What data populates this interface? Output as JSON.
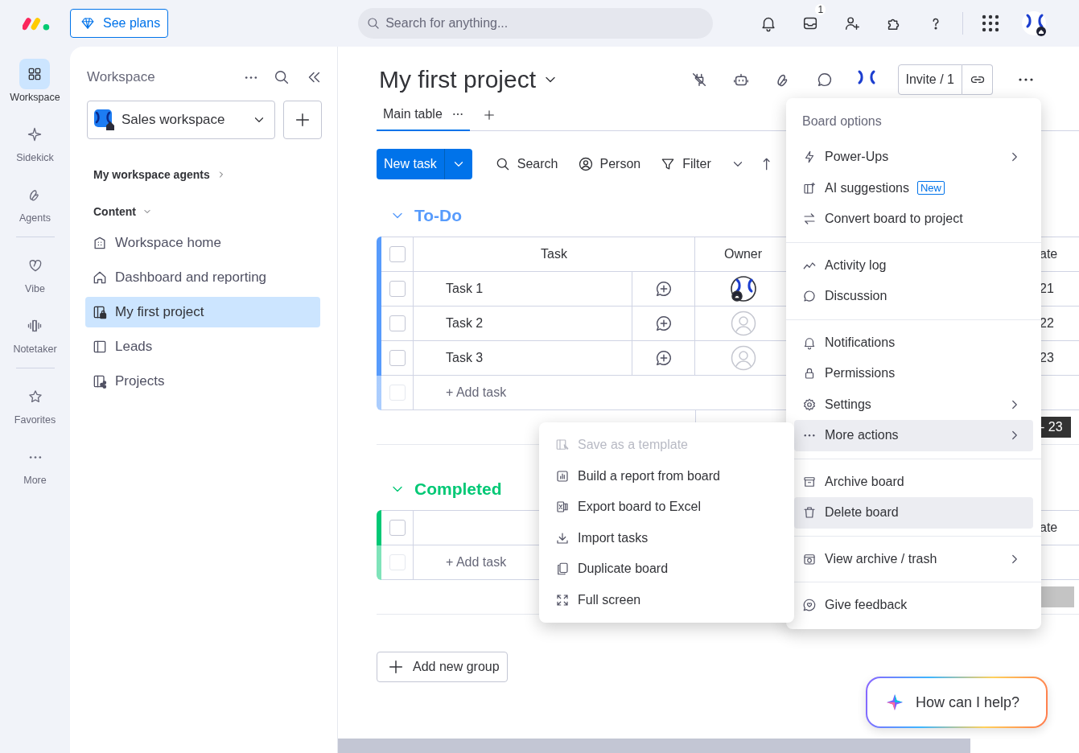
{
  "top_bar": {
    "upgrade_button": "See plans",
    "search": {
      "placeholder": "Search for anything..."
    },
    "inbox_badge": "1"
  },
  "rail": {
    "items": [
      {
        "label": "Workspace",
        "selected": true
      },
      {
        "label": "Sidekick",
        "selected": false
      },
      {
        "label": "Agents",
        "selected": false
      },
      {
        "label": "Vibe",
        "selected": false
      },
      {
        "label": "Notetaker",
        "selected": false
      },
      {
        "label": "Favorites",
        "selected": false
      },
      {
        "label": "More",
        "selected": false
      }
    ]
  },
  "workspace_panel": {
    "title": "Workspace",
    "workspace_select": "Sales workspace",
    "agents_link": "My workspace agents",
    "section": {
      "label": "Content",
      "expanded": true
    },
    "items": [
      {
        "label": "Workspace home",
        "selected": false
      },
      {
        "label": "Dashboard and reporting",
        "selected": false
      },
      {
        "label": "My first project",
        "selected": true
      },
      {
        "label": "Leads",
        "selected": false
      },
      {
        "label": "Projects",
        "selected": false
      }
    ]
  },
  "board": {
    "title": "My first project",
    "invite_button": "Invite / 1",
    "views": [
      {
        "label": "Main table",
        "selected": true
      }
    ],
    "new_task_button": "New task",
    "toolbar": [
      "Search",
      "Person",
      "Filter"
    ],
    "groups": [
      {
        "name": "To-Do",
        "color": "#579bfc",
        "columns": {
          "task": "Task",
          "owner": "Owner",
          "column_4": "ate"
        },
        "header_checked": false,
        "add_row_checked": false,
        "rows": [
          {
            "name": "Task 1",
            "checked": false,
            "owner_assigned": true,
            "column_4": "21"
          },
          {
            "name": "Task 2",
            "checked": false,
            "owner_assigned": false,
            "column_4": "22"
          },
          {
            "name": "Task 3",
            "checked": false,
            "owner_assigned": false,
            "column_4": "23"
          }
        ],
        "add_row": "+ Add task",
        "summary": "- 23"
      },
      {
        "name": "Completed",
        "color": "#00c875",
        "columns": {
          "column_4": "ate"
        },
        "header_checked": false,
        "add_row_checked": false,
        "add_row": "+ Add task"
      }
    ],
    "add_group_button": "Add new group"
  },
  "board_menu": {
    "title": "Board options",
    "sections": [
      {
        "items": [
          {
            "label": "Power-Ups",
            "submenu": true,
            "highlighted": false
          },
          {
            "label": "AI suggestions",
            "badge": "New",
            "submenu": false,
            "highlighted": false
          },
          {
            "label": "Convert board to project",
            "submenu": false,
            "highlighted": false
          }
        ]
      },
      {
        "items": [
          {
            "label": "Activity log",
            "submenu": false,
            "highlighted": false
          },
          {
            "label": "Discussion",
            "submenu": false,
            "highlighted": false
          }
        ]
      },
      {
        "items": [
          {
            "label": "Notifications",
            "submenu": false,
            "highlighted": false
          },
          {
            "label": "Permissions",
            "submenu": false,
            "highlighted": false
          },
          {
            "label": "Settings",
            "submenu": true,
            "highlighted": false
          },
          {
            "label": "More actions",
            "submenu": true,
            "highlighted": true
          }
        ]
      },
      {
        "items": [
          {
            "label": "Archive board",
            "submenu": false,
            "highlighted": false
          },
          {
            "label": "Delete board",
            "submenu": false,
            "highlighted": true
          }
        ]
      },
      {
        "items": [
          {
            "label": "View archive / trash",
            "submenu": true,
            "highlighted": false
          }
        ]
      },
      {
        "items": [
          {
            "label": "Give feedback",
            "submenu": false,
            "highlighted": false
          }
        ]
      }
    ]
  },
  "more_actions_menu": {
    "items": [
      {
        "label": "Save as a template",
        "disabled": true
      },
      {
        "label": "Build a report from board",
        "disabled": false
      },
      {
        "label": "Export board to Excel",
        "disabled": false
      },
      {
        "label": "Import tasks",
        "disabled": false
      },
      {
        "label": "Duplicate board",
        "disabled": false
      },
      {
        "label": "Full screen",
        "disabled": false
      }
    ]
  },
  "assistant": {
    "prompt": "How can I help?"
  }
}
